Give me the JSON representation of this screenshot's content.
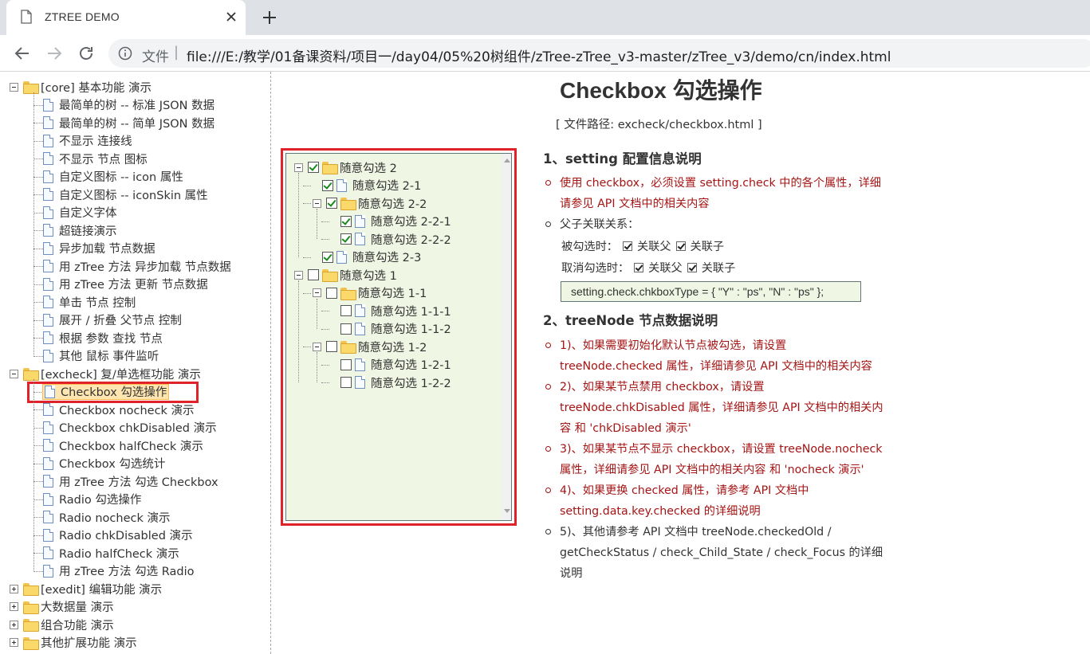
{
  "browser": {
    "tab_title": "ZTREE DEMO",
    "address_scheme": "文件",
    "address_sep": "|",
    "address_url": "file:///E:/教学/01备课资料/项目一/day04/05%20树组件/zTree-zTree_v3-master/zTree_v3/demo/cn/index.html"
  },
  "nav": {
    "groups": [
      {
        "label": "[core] 基本功能 演示",
        "expanded": true,
        "items": [
          "最简单的树 -- 标准 JSON 数据",
          "最简单的树 -- 简单 JSON 数据",
          "不显示 连接线",
          "不显示 节点 图标",
          "自定义图标 -- icon 属性",
          "自定义图标 -- iconSkin 属性",
          "自定义字体",
          "超链接演示",
          "异步加载 节点数据",
          "用 zTree 方法 异步加载 节点数据",
          "用 zTree 方法 更新 节点数据",
          "单击 节点 控制",
          "展开 / 折叠 父节点 控制",
          "根据 参数 查找 节点",
          "其他 鼠标 事件监听"
        ]
      },
      {
        "label": "[excheck] 复/单选框功能 演示",
        "expanded": true,
        "items": [
          "Checkbox 勾选操作",
          "Checkbox nocheck 演示",
          "Checkbox chkDisabled 演示",
          "Checkbox halfCheck 演示",
          "Checkbox 勾选统计",
          "用 zTree 方法 勾选 Checkbox",
          "Radio 勾选操作",
          "Radio nocheck 演示",
          "Radio chkDisabled 演示",
          "Radio halfCheck 演示",
          "用 zTree 方法 勾选 Radio"
        ]
      },
      {
        "label": "[exedit] 编辑功能 演示",
        "expanded": false,
        "items": []
      },
      {
        "label": "大数据量 演示",
        "expanded": false,
        "items": []
      },
      {
        "label": "组合功能 演示",
        "expanded": false,
        "items": []
      },
      {
        "label": "其他扩展功能 演示",
        "expanded": false,
        "items": []
      }
    ],
    "selected": "Checkbox 勾选操作"
  },
  "demo_tree": [
    {
      "label": "随意勾选 2",
      "checked": true,
      "type": "folder",
      "level": 0
    },
    {
      "label": "随意勾选 2-1",
      "checked": true,
      "type": "doc",
      "level": 1
    },
    {
      "label": "随意勾选 2-2",
      "checked": true,
      "type": "folder",
      "level": 1
    },
    {
      "label": "随意勾选 2-2-1",
      "checked": true,
      "type": "doc",
      "level": 2
    },
    {
      "label": "随意勾选 2-2-2",
      "checked": true,
      "type": "doc",
      "level": 2
    },
    {
      "label": "随意勾选 2-3",
      "checked": true,
      "type": "doc",
      "level": 1
    },
    {
      "label": "随意勾选 1",
      "checked": false,
      "type": "folder",
      "level": 0
    },
    {
      "label": "随意勾选 1-1",
      "checked": false,
      "type": "folder",
      "level": 1
    },
    {
      "label": "随意勾选 1-1-1",
      "checked": false,
      "type": "doc",
      "level": 2
    },
    {
      "label": "随意勾选 1-1-2",
      "checked": false,
      "type": "doc",
      "level": 2
    },
    {
      "label": "随意勾选 1-2",
      "checked": false,
      "type": "folder",
      "level": 1
    },
    {
      "label": "随意勾选 1-2-1",
      "checked": false,
      "type": "doc",
      "level": 2
    },
    {
      "label": "随意勾选 1-2-2",
      "checked": false,
      "type": "doc",
      "level": 2
    }
  ],
  "content": {
    "title": "Checkbox 勾选操作",
    "file_path": "[ 文件路径: excheck/checkbox.html ]",
    "section1_title": "1、setting 配置信息说明",
    "s1_item1": "使用 checkbox，必须设置 setting.check 中的各个属性，详细请参见 API 文档中的相关内容",
    "s1_item2": "父子关联关系：",
    "checked_label": "被勾选时：",
    "unchecked_label": "取消勾选时：",
    "assoc_parent": "关联父",
    "assoc_child": "关联子",
    "code": "setting.check.chkboxType = { \"Y\" : \"ps\", \"N\" : \"ps\" };",
    "section2_title": "2、treeNode 节点数据说明",
    "s2_item1": "1)、如果需要初始化默认节点被勾选，请设置 treeNode.checked 属性，详细请参见 API 文档中的相关内容",
    "s2_item2": "2)、如果某节点禁用 checkbox，请设置 treeNode.chkDisabled 属性，详细请参见 API 文档中的相关内容 和 'chkDisabled 演示'",
    "s2_item3": "3)、如果某节点不显示 checkbox，请设置 treeNode.nocheck 属性，详细请参见 API 文档中的相关内容 和 'nocheck 演示'",
    "s2_item4": "4)、如果更换 checked 属性，请参考 API 文档中 setting.data.key.checked 的详细说明",
    "s2_item5": "5)、其他请参考 API 文档中 treeNode.checkedOld / getCheckStatus / check_Child_State / check_Focus 的详细说明"
  }
}
